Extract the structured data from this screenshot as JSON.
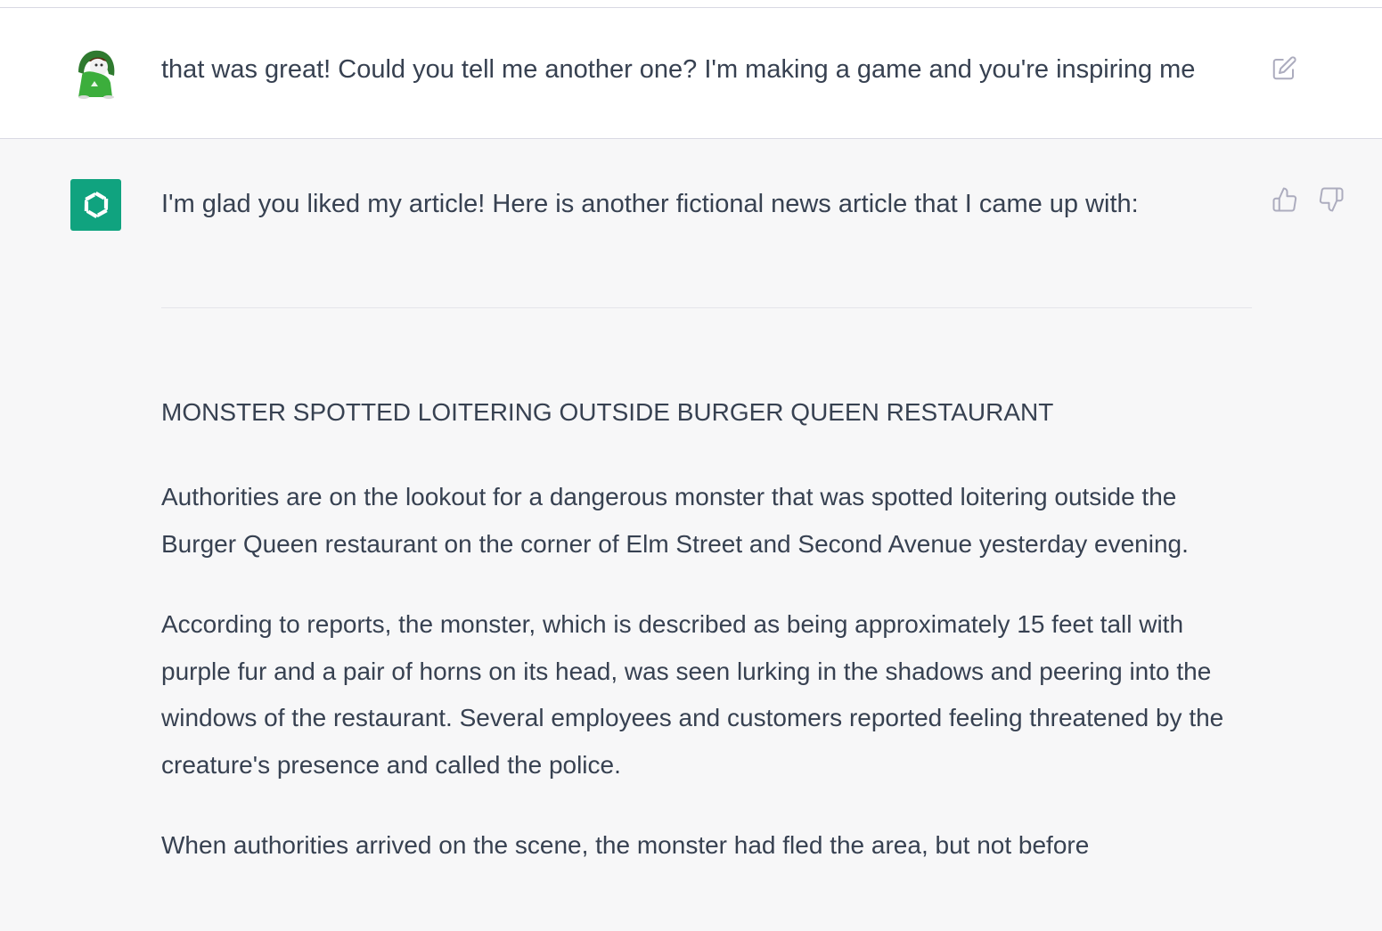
{
  "conversation": {
    "user_message": {
      "text": "that was great! Could you tell me another one? I'm making a game and you're inspiring me",
      "avatar_icon": "hooded-character-avatar-icon",
      "edit_icon": "edit-icon"
    },
    "assistant_message": {
      "avatar_icon": "openai-logo-icon",
      "avatar_color": "#10a37f",
      "intro": "I'm glad you liked my article! Here is another fictional news article that I came up with:",
      "headline": "MONSTER SPOTTED LOITERING OUTSIDE BURGER QUEEN RESTAURANT",
      "paragraphs": [
        "Authorities are on the lookout for a dangerous monster that was spotted loitering outside the Burger Queen restaurant on the corner of Elm Street and Second Avenue yesterday evening.",
        "According to reports, the monster, which is described as being approximately 15 feet tall with purple fur and a pair of horns on its head, was seen lurking in the shadows and peering into the windows of the restaurant. Several employees and customers reported feeling threatened by the creature's presence and called the police.",
        "When authorities arrived on the scene, the monster had fled the area, but not before"
      ],
      "feedback": {
        "thumbs_up_icon": "thumbs-up-icon",
        "thumbs_down_icon": "thumbs-down-icon"
      }
    }
  }
}
